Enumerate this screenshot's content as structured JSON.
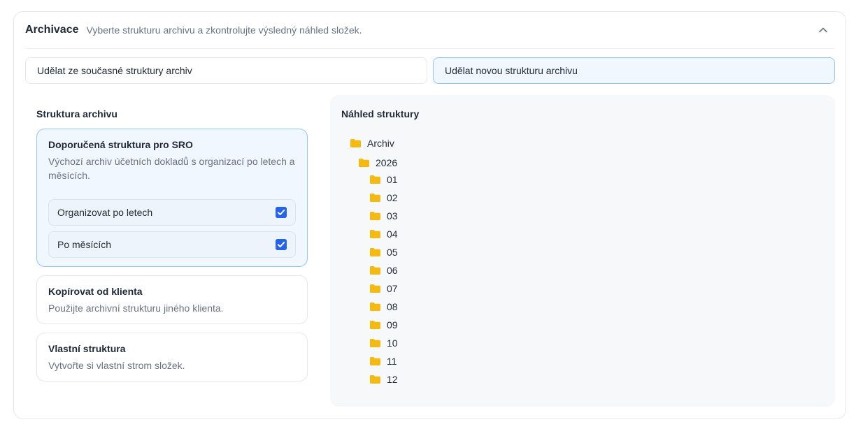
{
  "header": {
    "title": "Archivace",
    "subtitle": "Vyberte strukturu archivu a zkontrolujte výsledný náhled složek."
  },
  "modes": {
    "existing": "Udělat ze současné struktury archiv",
    "new": "Udělat novou strukturu archivu",
    "selected": "new"
  },
  "structure": {
    "heading": "Struktura archivu",
    "options": [
      {
        "title": "Doporučená struktura pro SRO",
        "description": "Výchozí archiv účetních dokladů s organizací po letech a měsících.",
        "selected": true,
        "checkboxes": [
          {
            "label": "Organizovat po letech",
            "checked": true
          },
          {
            "label": "Po měsících",
            "checked": true
          }
        ]
      },
      {
        "title": "Kopírovat od klienta",
        "description": "Použijte archivní strukturu jiného klienta.",
        "selected": false
      },
      {
        "title": "Vlastní struktura",
        "description": "Vytvořte si vlastní strom složek.",
        "selected": false
      }
    ]
  },
  "preview": {
    "heading": "Náhled struktury",
    "root": "Archiv",
    "year": "2026",
    "months": [
      "01",
      "02",
      "03",
      "04",
      "05",
      "06",
      "07",
      "08",
      "09",
      "10",
      "11",
      "12"
    ]
  },
  "colors": {
    "accent": "#2563eb",
    "folder": "#f5b90f",
    "selected_bg": "#f0f7ff",
    "selected_border": "#93c5fd"
  }
}
